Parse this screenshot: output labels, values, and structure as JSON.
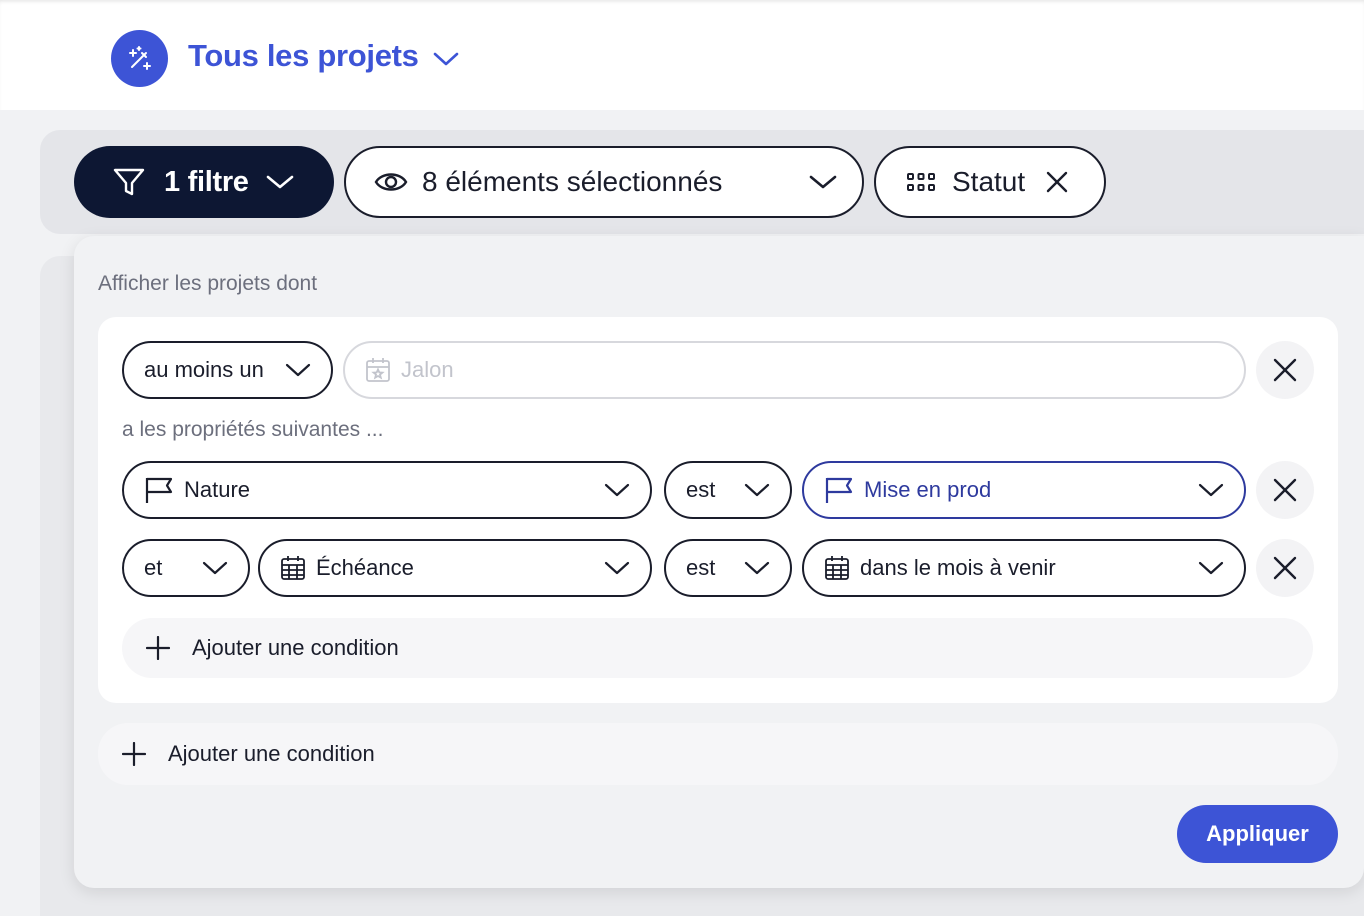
{
  "header": {
    "title": "Tous les projets",
    "logo_icon": "magic-wand-icon",
    "chevron_icon": "chevron-down-icon"
  },
  "toolbar": {
    "filter_label": "1 filtre",
    "filter_icon": "funnel-icon",
    "elements_label": "8 éléments sélectionnés",
    "elements_icon": "eye-icon",
    "group_label": "Statut",
    "group_icon": "grid-dots-icon",
    "remove_icon": "close-icon"
  },
  "filter_panel": {
    "heading": "Afficher les projets dont",
    "group": {
      "quantifier": "au moins un",
      "entity_placeholder": "Jalon",
      "entity_icon": "calendar-star-icon",
      "subheading": "a les propriétés suivantes ...",
      "conditions": [
        {
          "connector": "",
          "property": "Nature",
          "property_icon": "flag-icon",
          "operator": "est",
          "value": "Mise en prod",
          "value_icon": "flag-icon"
        },
        {
          "connector": "et",
          "property": "Échéance",
          "property_icon": "calendar-icon",
          "operator": "est",
          "value": "dans le mois à venir",
          "value_icon": "calendar-icon"
        }
      ],
      "add_condition_label": "Ajouter une condition"
    },
    "add_condition_label": "Ajouter une condition",
    "apply_label": "Appliquer"
  },
  "colors": {
    "accent": "#3d54d6",
    "dark": "#0d1733",
    "text": "#1a1d2b",
    "muted": "#6c6f7d"
  }
}
